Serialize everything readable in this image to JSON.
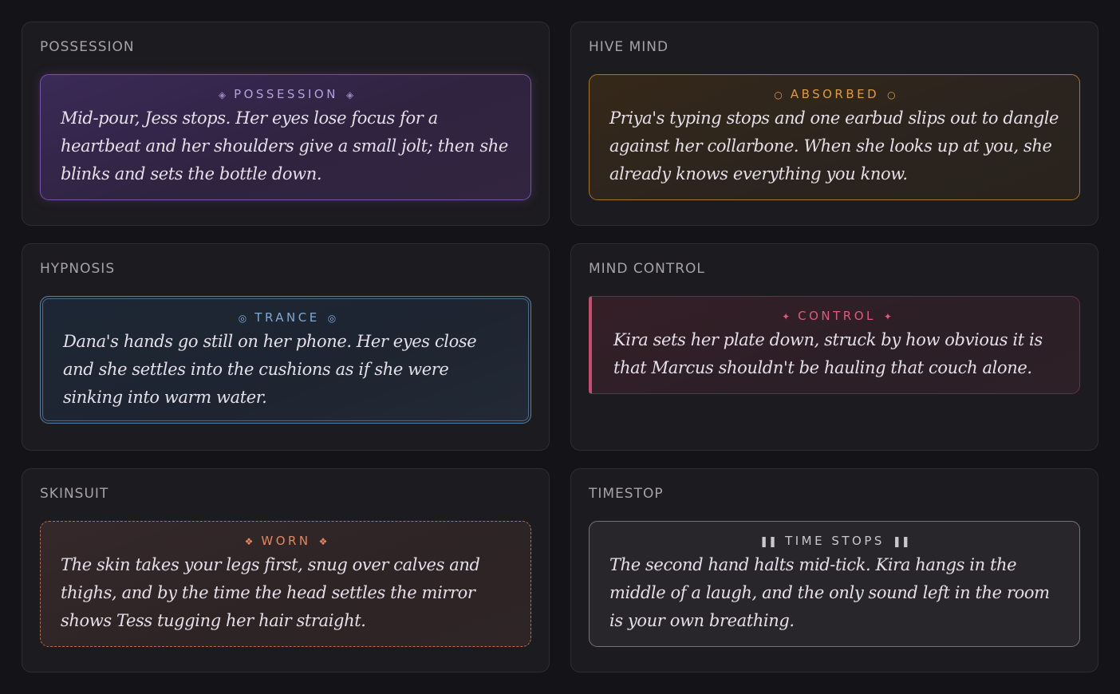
{
  "panels": [
    {
      "title": "POSSESSION",
      "label": "POSSESSION",
      "glyph": "◈",
      "text": "Mid-pour, Jess stops. Her eyes lose focus for a heartbeat and her shoulders give a small jolt; then she blinks and sets the bottle down."
    },
    {
      "title": "HIVE MIND",
      "label": "ABSORBED",
      "glyph": "○",
      "text": "Priya's typing stops and one earbud slips out to dangle against her collarbone. When she looks up at you, she already knows everything you know."
    },
    {
      "title": "HYPNOSIS",
      "label": "TRANCE",
      "glyph": "◎",
      "text": "Dana's hands go still on her phone. Her eyes close and she settles into the cushions as if she were sinking into warm water."
    },
    {
      "title": "MIND CONTROL",
      "label": "CONTROL",
      "glyph": "✦",
      "text": "Kira sets her plate down, struck by how obvious it is that Marcus shouldn't be hauling that couch alone."
    },
    {
      "title": "SKINSUIT",
      "label": "WORN",
      "glyph": "❖",
      "text": "The skin takes your legs first, snug over calves and thighs, and by the time the head settles the mirror shows Tess tugging her hair straight."
    },
    {
      "title": "TIMESTOP",
      "label": "TIME STOPS",
      "glyph": "❚❚",
      "text": "The second hand halts mid-tick. Kira hangs in the middle of a laugh, and the only sound left in the room is your own breathing."
    }
  ]
}
